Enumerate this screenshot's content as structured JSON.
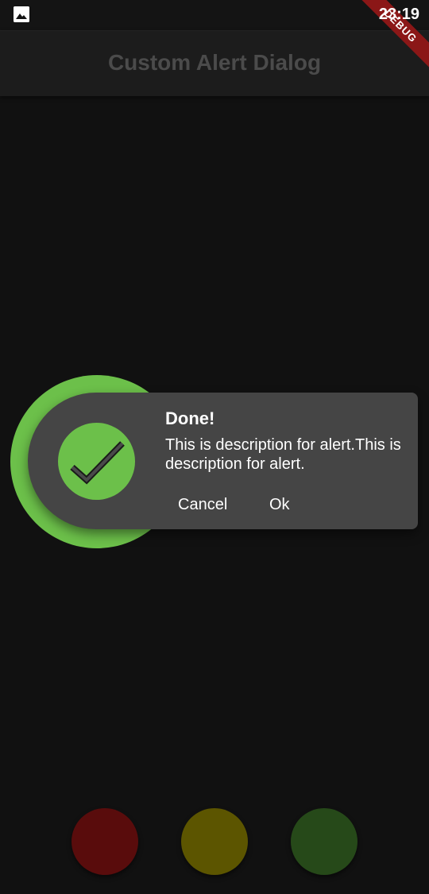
{
  "status_bar": {
    "time": "23:19",
    "debug_label": "DEBUG",
    "icon": "gallery-icon"
  },
  "app_bar": {
    "title": "Custom Alert Dialog"
  },
  "dialog": {
    "icon": "check-icon",
    "title": "Done!",
    "description": "This is description for alert.This is description for alert.",
    "cancel_label": "Cancel",
    "ok_label": "Ok",
    "accent_color": "#6cc04a"
  },
  "bottom_buttons": [
    {
      "name": "red",
      "color": "#590c0c"
    },
    {
      "name": "yellow",
      "color": "#5c5500"
    },
    {
      "name": "green",
      "color": "#264919"
    }
  ]
}
